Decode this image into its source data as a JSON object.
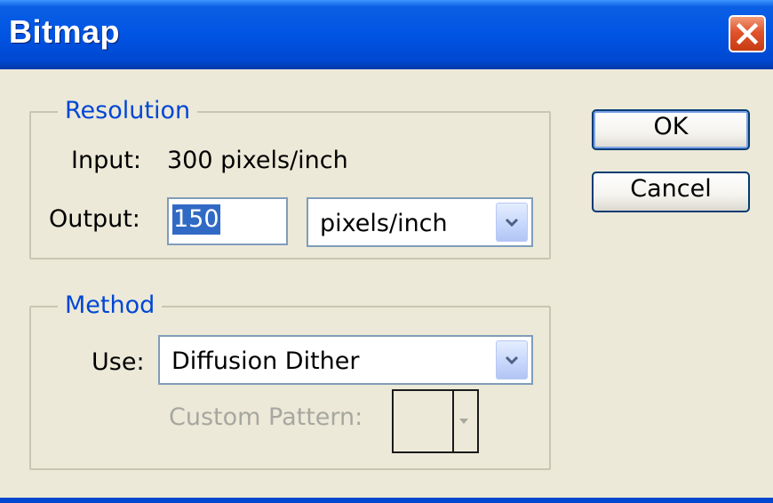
{
  "window": {
    "title": "Bitmap"
  },
  "resolution": {
    "legend": "Resolution",
    "input_label": "Input:",
    "input_value": "300 pixels/inch",
    "output_label": "Output:",
    "output_value": "150",
    "output_unit": "pixels/inch"
  },
  "method": {
    "legend": "Method",
    "use_label": "Use:",
    "use_value": "Diffusion Dither",
    "custom_pattern_label": "Custom Pattern:"
  },
  "buttons": {
    "ok": "OK",
    "cancel": "Cancel"
  },
  "icons": {
    "close": "close-icon",
    "dropdown": "chevron-down-icon"
  },
  "colors": {
    "titlebar": "#0054e3",
    "legend_text": "#0046d5",
    "selection": "#316ac5",
    "close_button": "#e0532c"
  }
}
